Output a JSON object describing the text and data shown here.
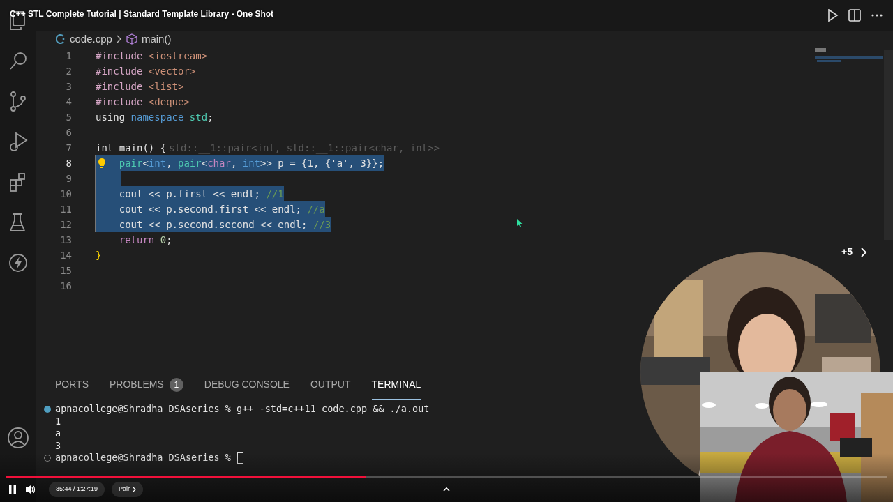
{
  "video": {
    "title": "C++ STL Complete Tutorial | Standard Template Library - One Shot",
    "playing": true,
    "progress": {
      "level": 0.409
    },
    "time": "35:44 / 1:27:19",
    "chapter": "Pair",
    "end_screen": "+5"
  },
  "editor": {
    "breadcrumb": [
      "code.cpp",
      "main()"
    ],
    "lines": [
      {
        "number": "1",
        "selected": false,
        "current": false,
        "lightbulb": false,
        "tokens": [
          {
            "kind": "directive",
            "text": "#include "
          },
          {
            "kind": "string",
            "text": "<iostream>"
          }
        ]
      },
      {
        "number": "2",
        "selected": false,
        "current": false,
        "lightbulb": false,
        "tokens": [
          {
            "kind": "directive",
            "text": "#include "
          },
          {
            "kind": "string",
            "text": "<vector>"
          }
        ]
      },
      {
        "number": "3",
        "selected": false,
        "current": false,
        "lightbulb": false,
        "tokens": [
          {
            "kind": "directive",
            "text": "#include "
          },
          {
            "kind": "string",
            "text": "<list>"
          }
        ]
      },
      {
        "number": "4",
        "selected": false,
        "current": false,
        "lightbulb": false,
        "tokens": [
          {
            "kind": "directive",
            "text": "#include "
          },
          {
            "kind": "string",
            "text": "<deque>"
          }
        ]
      },
      {
        "number": "5",
        "selected": false,
        "current": false,
        "lightbulb": false,
        "tokens": [
          {
            "kind": "plain",
            "text": "using "
          },
          {
            "kind": "keyword",
            "text": "namespace"
          },
          {
            "kind": "type",
            "text": " std"
          },
          {
            "kind": "plain",
            "text": ";"
          }
        ]
      },
      {
        "number": "6",
        "selected": false,
        "current": false,
        "lightbulb": false
      },
      {
        "number": "7",
        "selected": false,
        "current": false,
        "lightbulb": false,
        "tokens": [
          {
            "kind": "plain",
            "text": "int main() {"
          },
          {
            "kind": "hint",
            "text": "std::__1::pair<int, std::__1::pair<char, int>>"
          }
        ]
      },
      {
        "number": "8",
        "selected": true,
        "current": true,
        "lightbulb": true,
        "tokens": [
          {
            "kind": "type",
            "text": "    pair"
          },
          {
            "kind": "plain",
            "text": "<"
          },
          {
            "kind": "keyword",
            "text": "int"
          },
          {
            "kind": "plain",
            "text": ", "
          },
          {
            "kind": "type",
            "text": "pair"
          },
          {
            "kind": "plain",
            "text": "<"
          },
          {
            "kind": "control",
            "text": "char"
          },
          {
            "kind": "plain",
            "text": ", "
          },
          {
            "kind": "keyword",
            "text": "int"
          },
          {
            "kind": "plain",
            "text": ">> p = {1, {'a', 3}};"
          }
        ]
      },
      {
        "number": "9",
        "selected": true,
        "current": false,
        "lightbulb": false
      },
      {
        "number": "10",
        "selected": true,
        "current": false,
        "lightbulb": false,
        "tokens": [
          {
            "kind": "plain",
            "text": "    cout << p.first << endl; "
          },
          {
            "kind": "comment",
            "text": "//1"
          }
        ]
      },
      {
        "number": "11",
        "selected": true,
        "current": false,
        "lightbulb": false,
        "tokens": [
          {
            "kind": "plain",
            "text": "    cout << p.second.first << endl; "
          },
          {
            "kind": "comment",
            "text": "//a"
          }
        ]
      },
      {
        "number": "12",
        "selected": true,
        "current": false,
        "lightbulb": false,
        "tokens": [
          {
            "kind": "plain",
            "text": "    cout << p.second.second << endl; "
          },
          {
            "kind": "comment",
            "text": "//3"
          }
        ]
      },
      {
        "number": "13",
        "selected": false,
        "current": false,
        "lightbulb": false,
        "tokens": [
          {
            "kind": "control",
            "text": "    return"
          },
          {
            "kind": "number",
            "text": " 0"
          },
          {
            "kind": "plain",
            "text": ";"
          }
        ]
      },
      {
        "number": "14",
        "selected": false,
        "current": false,
        "lightbulb": false,
        "tokens": [
          {
            "kind": "bracket",
            "text": "}"
          }
        ]
      },
      {
        "number": "15",
        "selected": false,
        "current": false,
        "lightbulb": false
      },
      {
        "number": "16",
        "selected": false,
        "current": false,
        "lightbulb": false
      }
    ]
  },
  "panel": {
    "tabs": [
      {
        "label": "PORTS",
        "selected": false
      },
      {
        "label": "PROBLEMS",
        "badge": "1",
        "selected": false
      },
      {
        "label": "DEBUG CONSOLE",
        "selected": false
      },
      {
        "label": "OUTPUT",
        "selected": false
      },
      {
        "label": "TERMINAL",
        "selected": true
      }
    ],
    "terminal": [
      {
        "kind": "prompt",
        "completed": true,
        "text": "apnacollege@Shradha DSAseries % g++ -std=c++11 code.cpp && ./a.out"
      },
      {
        "kind": "output",
        "text": "1"
      },
      {
        "kind": "output",
        "text": "a"
      },
      {
        "kind": "output",
        "text": "3"
      },
      {
        "kind": "prompt",
        "completed": false,
        "text": "apnacollege@Shradha DSAseries %"
      }
    ]
  }
}
